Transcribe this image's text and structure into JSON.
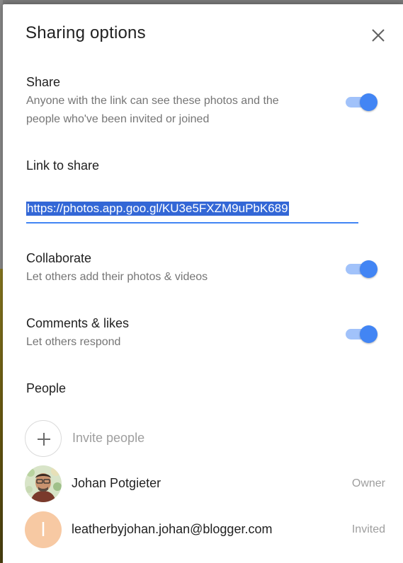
{
  "dialog": {
    "title": "Sharing options",
    "close_icon": "close-icon"
  },
  "share": {
    "title": "Share",
    "description_line1": "Anyone with the link can see these photos and the",
    "description_line2": "people who've been invited or joined",
    "enabled": true
  },
  "link": {
    "title": "Link to share",
    "url": "https://photos.app.goo.gl/KU3e5FXZM9uPbK689"
  },
  "collaborate": {
    "title": "Collaborate",
    "description": "Let others add their photos & videos",
    "enabled": true
  },
  "comments": {
    "title": "Comments & likes",
    "description": "Let others respond",
    "enabled": true
  },
  "people": {
    "title": "People",
    "invite_label": "Invite people",
    "invite_icon": "plus-icon",
    "members": [
      {
        "name": "Johan Potgieter",
        "role": "Owner",
        "avatar": "photo"
      },
      {
        "name": "leatherbyjohan.johan@blogger.com",
        "role": "Invited",
        "avatar_letter": "l"
      }
    ]
  },
  "colors": {
    "accent": "#4285f4",
    "toggle_track": "#a1c2fa",
    "selection": "#3367d6",
    "letter_avatar": "#f7c9a3"
  }
}
